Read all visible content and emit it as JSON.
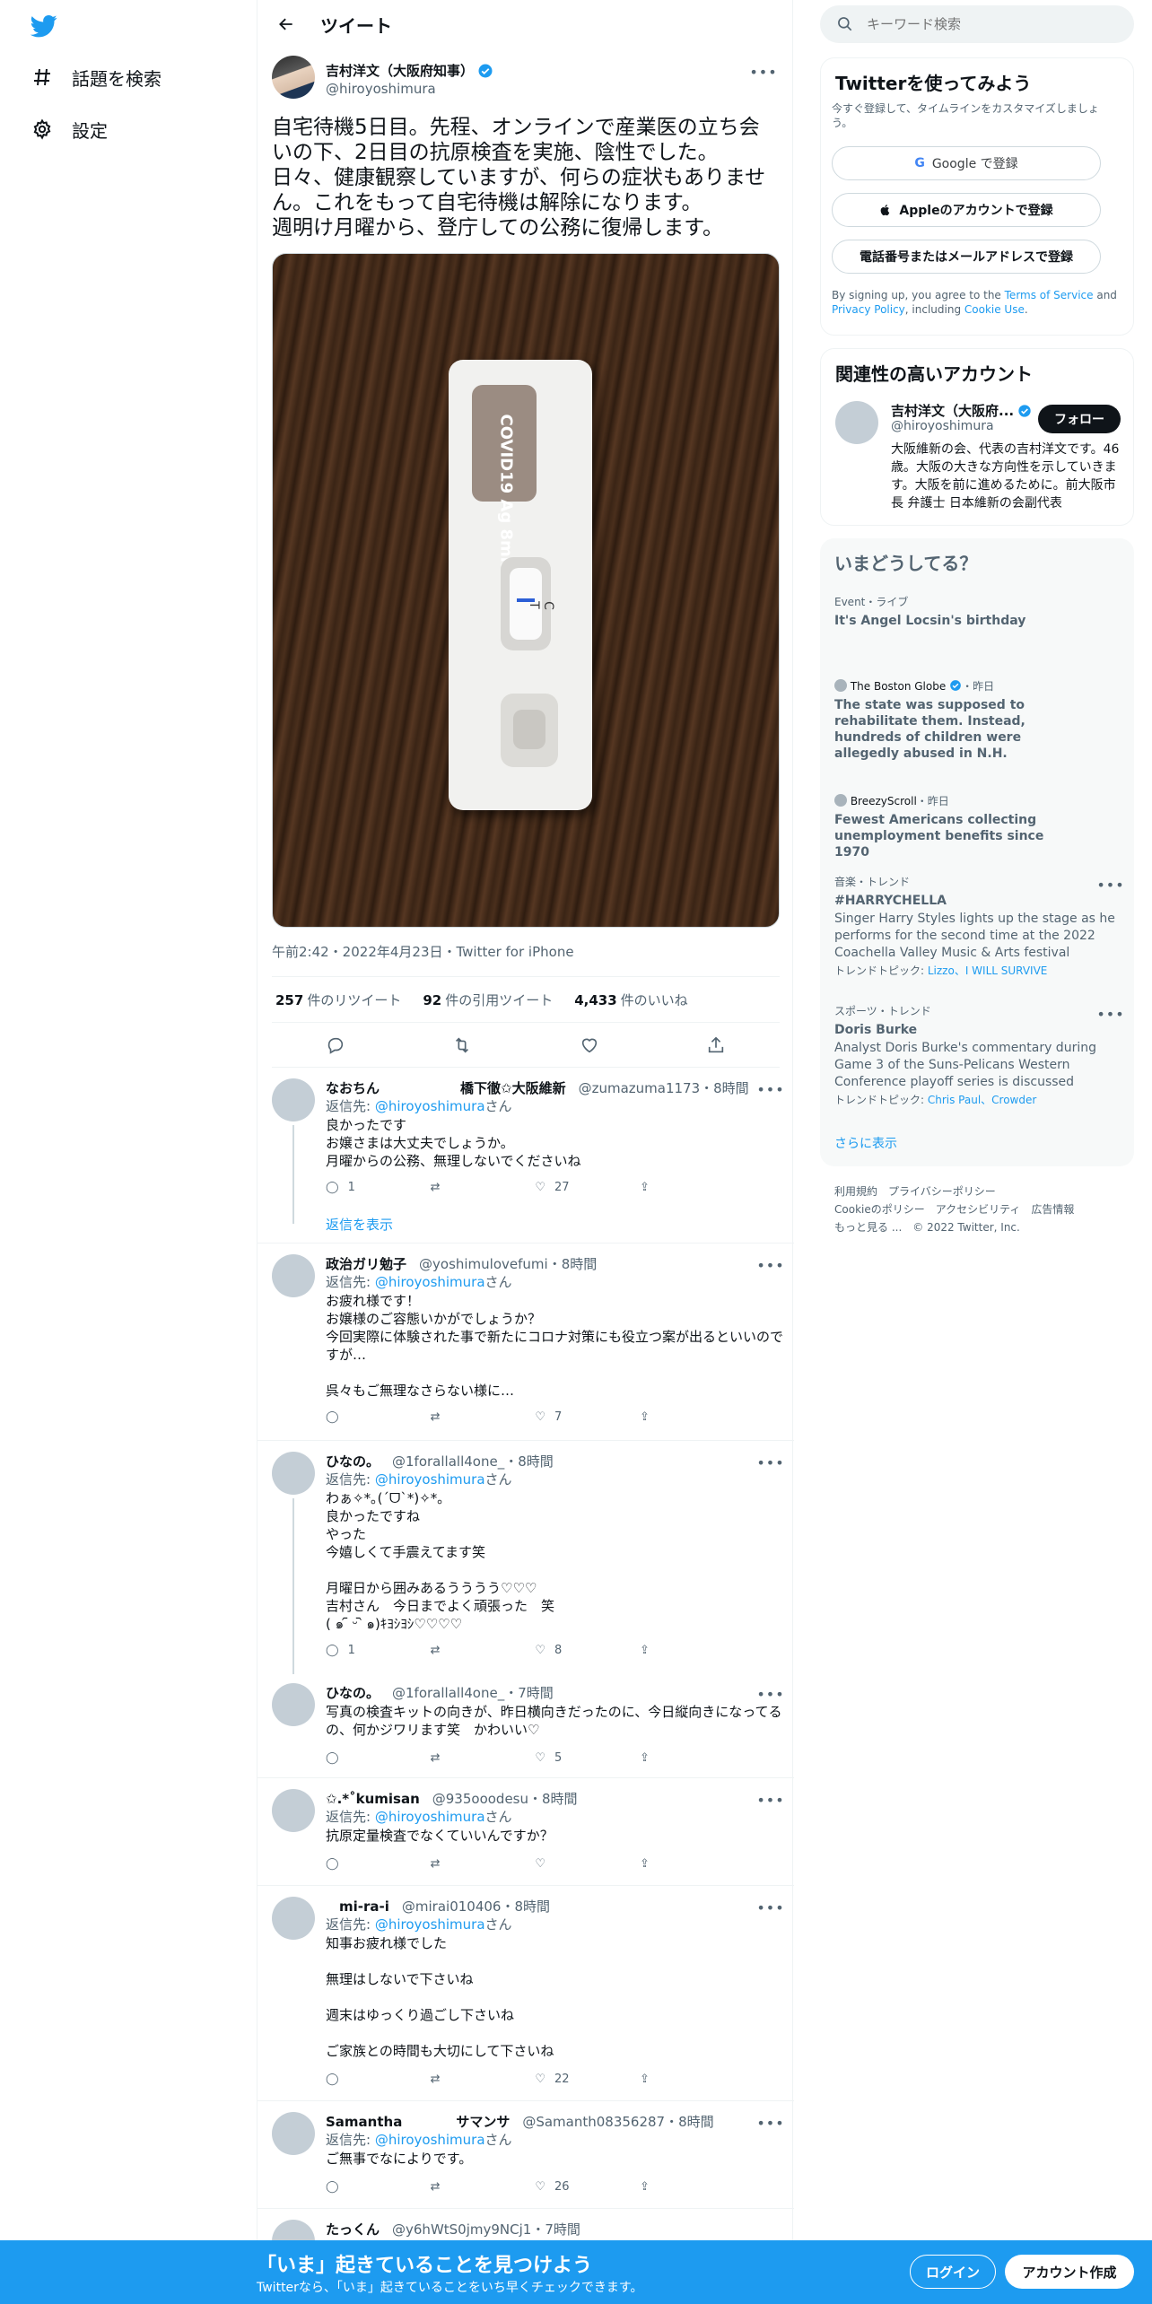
{
  "nav": {
    "explore_label": "話題を検索",
    "settings_label": "設定"
  },
  "header": {
    "title": "ツイート"
  },
  "tweet": {
    "author_name": "吉村洋文（大阪府知事）",
    "author_handle": "@hiroyoshimura",
    "text": "自宅待機5日目。先程、オンラインで産業医の立ち会いの下、2日目の抗原検査を実施、陰性でした。\n日々、健康観察していますが、何らの症状もありません。これをもって自宅待機は解除になります。\n週明け月曜から、登庁しての公務に復帰します。",
    "photo_label": "COVID19 Ag 8min",
    "photo_ct": "C T",
    "timestamp": "午前2:42・2022年4月23日・Twitter for iPhone",
    "retweets": "257",
    "retweets_label": "件のリツイート",
    "quotes": "92",
    "quotes_label": "件の引用ツイート",
    "likes": "4,433",
    "likes_label": "件のいいね"
  },
  "replies": [
    {
      "name": "なおちん　　　　　　橋下徹✩大阪維新",
      "handle": "@zumazuma1173・8時間",
      "reply_to_prefix": "返信先: ",
      "reply_to": "@hiroyoshimura",
      "reply_to_suffix": "さん",
      "text": "良かったです\nお嬢さまは大丈夫でしょうか。\n月曜からの公務、無理しないでくださいね",
      "replies": "1",
      "retweets": "",
      "likes": "27",
      "show_replies": "返信を表示"
    },
    {
      "name": "政治ガリ勉子",
      "handle": "@yoshimulovefumi・8時間",
      "reply_to_prefix": "返信先: ",
      "reply_to": "@hiroyoshimura",
      "reply_to_suffix": "さん",
      "text": "お疲れ様です！\nお嬢様のご容態いかがでしょうか？\n今回実際に体験された事で新たにコロナ対策にも役立つ案が出るといいのですが…\n\n呉々もご無理なさらない様に…",
      "replies": "",
      "retweets": "",
      "likes": "7"
    },
    {
      "name": "ひなの。",
      "handle": "@1forallall4one_・8時間",
      "reply_to_prefix": "返信先: ",
      "reply_to": "@hiroyoshimura",
      "reply_to_suffix": "さん",
      "text": "わぁ✧*｡(ˊᗜˋ*)✧*｡\n良かったですね\nやった\n今嬉しくて手震えてます笑\n\n月曜日から囲みあるうううう♡♡♡\n吉村さん　今日までよく頑張った　笑\n( ๑ ᷇ ᵕ ᷆ ๑)ｷﾖｼﾖｼ♡♡♡♡",
      "replies": "1",
      "retweets": "",
      "likes": "8"
    },
    {
      "name": "ひなの。",
      "handle": "@1forallall4one_・7時間",
      "text": "写真の検査キットの向きが、昨日横向きだったのに、今日縦向きになってるの、何かジワリます笑　かわいい♡",
      "replies": "",
      "retweets": "",
      "likes": "5"
    },
    {
      "name": "✩.*˚kumisan",
      "handle": "@935ooodesu・8時間",
      "reply_to_prefix": "返信先: ",
      "reply_to": "@hiroyoshimura",
      "reply_to_suffix": "さん",
      "text": "抗原定量検査でなくていいんですか？",
      "replies": "",
      "retweets": "",
      "likes": ""
    },
    {
      "name": "　mi-ra-i",
      "handle": "@mirai010406・8時間",
      "reply_to_prefix": "返信先: ",
      "reply_to": "@hiroyoshimura",
      "reply_to_suffix": "さん",
      "text": "知事お疲れ様でした\n\n無理はしないで下さいね\n\n週末はゆっくり過ごし下さいね\n\nご家族との時間も大切にして下さいね",
      "replies": "",
      "retweets": "",
      "likes": "22"
    },
    {
      "name": "Samantha　　　　サマンサ",
      "handle": "@Samanth08356287・8時間",
      "reply_to_prefix": "返信先: ",
      "reply_to": "@hiroyoshimura",
      "reply_to_suffix": "さん",
      "text": "ご無事でなによりです。",
      "replies": "",
      "retweets": "",
      "likes": "26"
    },
    {
      "name": "たっくん",
      "handle": "@y6hWtS0jmy9NCj1・7時間"
    }
  ],
  "search": {
    "placeholder": "キーワード検索"
  },
  "signup": {
    "title": "Twitterを使ってみよう",
    "subtitle": "今すぐ登録して、タイムラインをカスタマイズしましょう。",
    "google": "Google で登録",
    "apple": "Appleのアカウントで登録",
    "phone": "電話番号またはメールアドレスで登録",
    "terms_1": "By signing up, you agree to the ",
    "terms_link": "Terms of Service",
    "terms_2": " and ",
    "privacy_link": "Privacy Policy",
    "terms_3": ", including ",
    "cookie_link": "Cookie Use",
    "terms_4": "."
  },
  "related": {
    "title": "関連性の高いアカウント",
    "name": "吉村洋文（大阪府...",
    "handle": "@hiroyoshimura",
    "follow": "フォロー",
    "bio": "大阪維新の会、代表の吉村洋文です。46歳。大阪の大きな方向性を示していきます。大阪を前に進めるために。前大阪市長 弁護士 日本維新の会副代表"
  },
  "trends": {
    "title": "いまどうしてる？",
    "items": [
      {
        "cat": "Event・ライブ",
        "title": "It's Angel Locsin's birthday"
      },
      {
        "source": "The Boston Globe",
        "cat": "・昨日",
        "title": "The state was supposed to rehabilitate them. Instead, hundreds of children were allegedly abused in N.H."
      },
      {
        "source": "BreezyScroll",
        "cat": "・昨日",
        "title": "Fewest Americans collecting unemployment benefits since 1970"
      },
      {
        "cat": "音楽・トレンド",
        "title": "#HARRYCHELLA",
        "desc": "Singer Harry Styles lights up the stage as he performs for the second time at the 2022 Coachella Valley Music & Arts festival",
        "topics_label": "トレンドトピック: ",
        "topics": "Lizzo、I WILL SURVIVE"
      },
      {
        "cat": "スポーツ・トレンド",
        "title": "Doris Burke",
        "desc": "Analyst Doris Burke's commentary during Game 3 of the Suns-Pelicans Western Conference playoff series is discussed",
        "topics_label": "トレンドトピック: ",
        "topics": "Chris Paul、Crowder"
      }
    ],
    "show_more": "さらに表示"
  },
  "footer": {
    "line1": "利用規約　プライバシーポリシー",
    "line2": "Cookieのポリシー　アクセシビリティ　広告情報",
    "line3": "もっと見る ...　© 2022 Twitter, Inc."
  },
  "banner": {
    "title": "「いま」起きていることを見つけよう",
    "subtitle": "Twitterなら、「いま」起きていることをいち早くチェックできます。",
    "login": "ログイン",
    "signup": "アカウント作成"
  },
  "colors": {
    "accent": "#1d9bf0",
    "text": "#0f1419",
    "muted": "#536471"
  }
}
